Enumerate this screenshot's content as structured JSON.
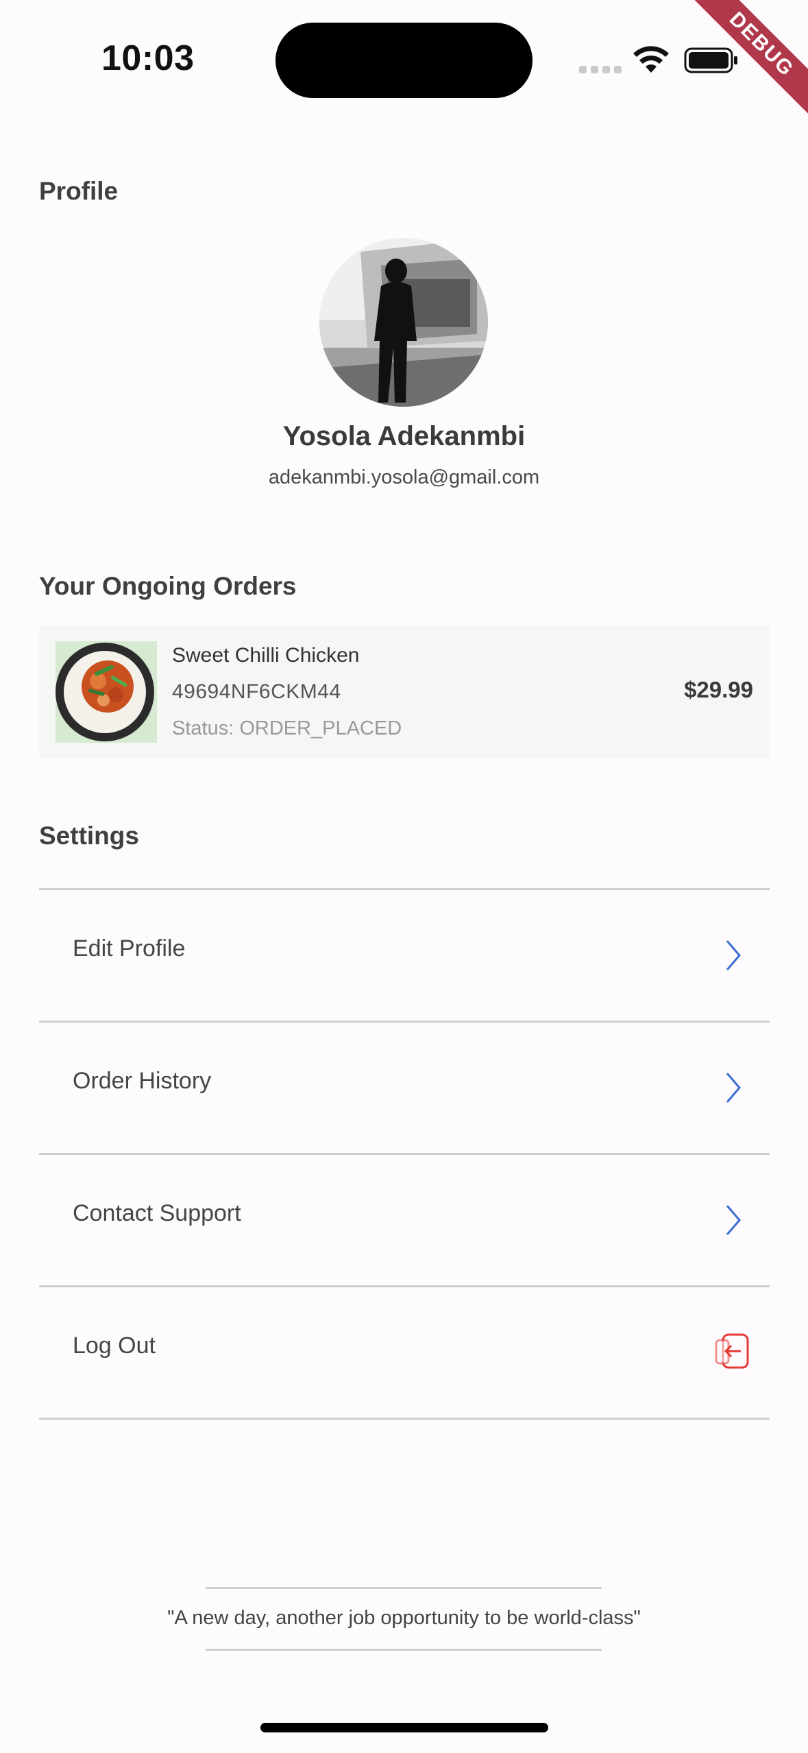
{
  "status_bar": {
    "time": "10:03"
  },
  "debug_label": "DEBUG",
  "profile": {
    "section_title": "Profile",
    "name": "Yosola Adekanmbi",
    "email": "adekanmbi.yosola@gmail.com"
  },
  "orders": {
    "section_title": "Your Ongoing Orders",
    "items": [
      {
        "name": "Sweet Chilli Chicken",
        "id": "49694NF6CKM44",
        "status": "Status: ORDER_PLACED",
        "price": "$29.99"
      }
    ]
  },
  "settings": {
    "section_title": "Settings",
    "items": [
      {
        "label": "Edit Profile",
        "icon": "chevron-right-icon"
      },
      {
        "label": "Order History",
        "icon": "chevron-right-icon"
      },
      {
        "label": "Contact Support",
        "icon": "chevron-right-icon"
      },
      {
        "label": "Log Out",
        "icon": "logout-icon"
      }
    ]
  },
  "quote": "\"A new day, another job opportunity to be world-class\"",
  "colors": {
    "background": "#fdfbfd",
    "chevron": "#3b6fd1",
    "logout": "#e53935",
    "debug": "#b0384a"
  }
}
